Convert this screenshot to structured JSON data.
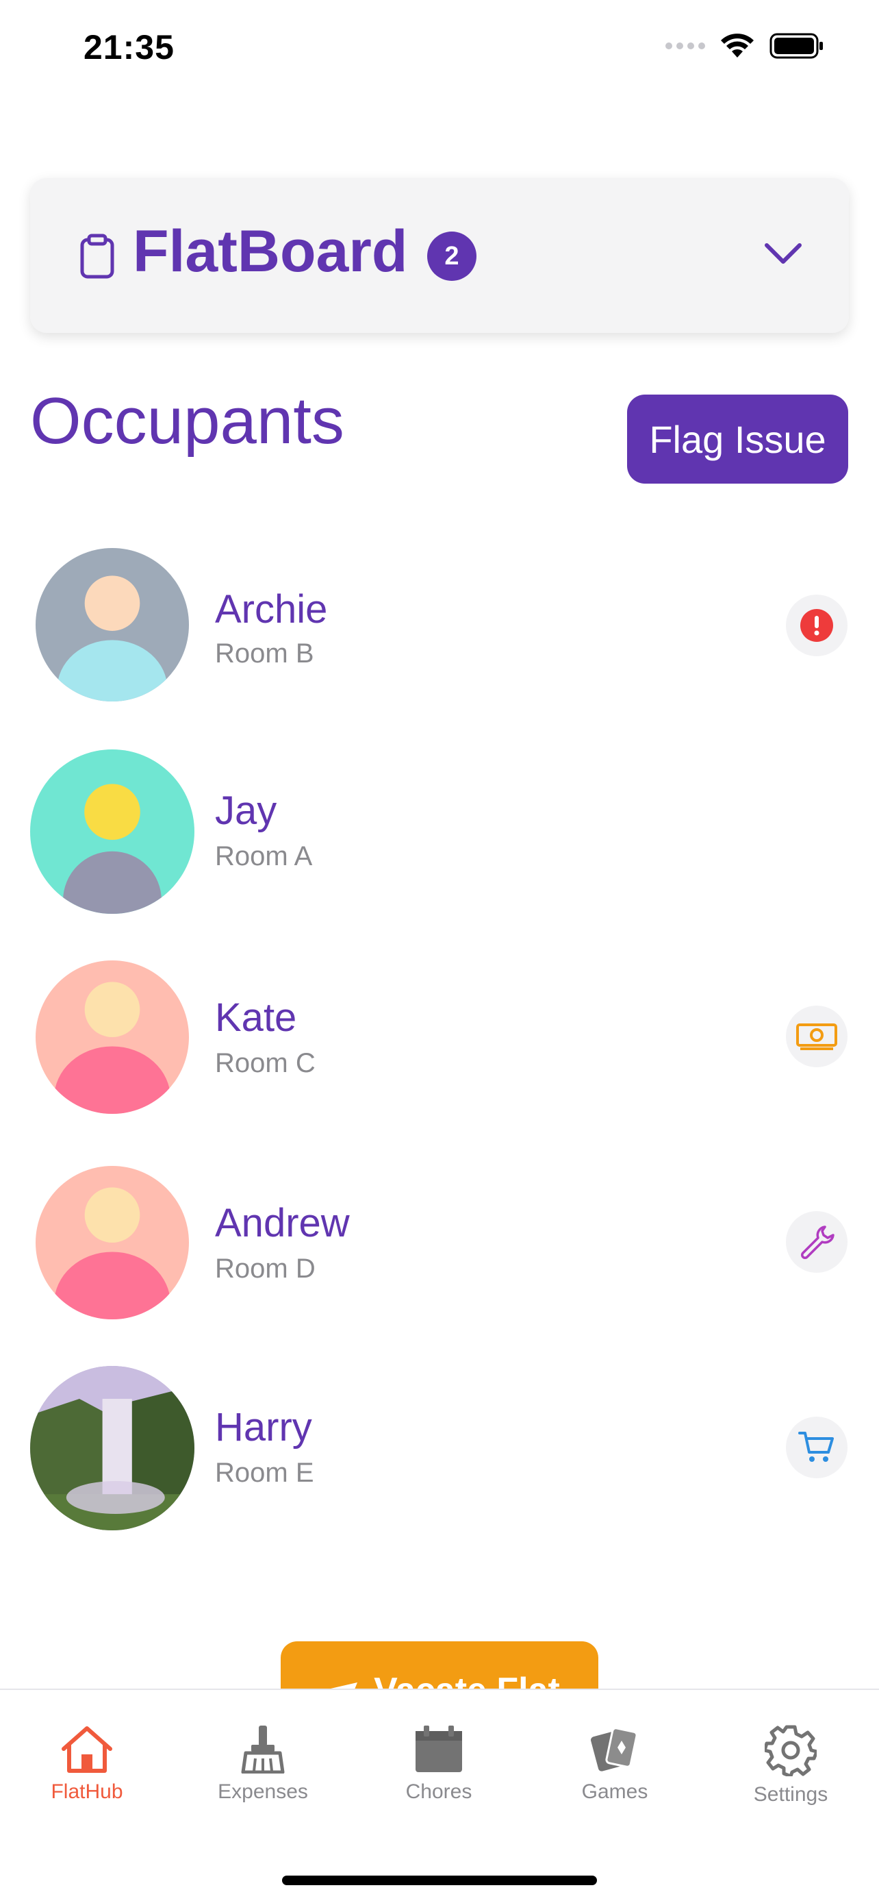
{
  "status_bar": {
    "time": "21:35"
  },
  "board": {
    "title": "FlatBoard",
    "badge_count": "2"
  },
  "occupants_section": {
    "title": "Occupants",
    "flag_issue_label": "Flag Issue"
  },
  "occupants": [
    {
      "name": "Archie",
      "room": "Room B",
      "status_icon": "alert-icon"
    },
    {
      "name": "Jay",
      "room": "Room A",
      "status_icon": ""
    },
    {
      "name": "Kate",
      "room": "Room C",
      "status_icon": "money-icon"
    },
    {
      "name": "Andrew",
      "room": "Room D",
      "status_icon": "wrench-icon"
    },
    {
      "name": "Harry",
      "room": "Room E",
      "status_icon": "cart-icon"
    }
  ],
  "vacate_label": "Vacate Flat",
  "tabs": [
    {
      "label": "FlatHub",
      "icon": "home-icon",
      "active": true
    },
    {
      "label": "Expenses",
      "icon": "broom-icon",
      "active": false
    },
    {
      "label": "Chores",
      "icon": "calendar-icon",
      "active": false
    },
    {
      "label": "Games",
      "icon": "cards-icon",
      "active": false
    },
    {
      "label": "Settings",
      "icon": "gear-icon",
      "active": false
    }
  ],
  "colors": {
    "primary": "#6035b0",
    "accent": "#f39c12",
    "active_tab": "#f05a3c",
    "alert": "#ee3b3b"
  }
}
